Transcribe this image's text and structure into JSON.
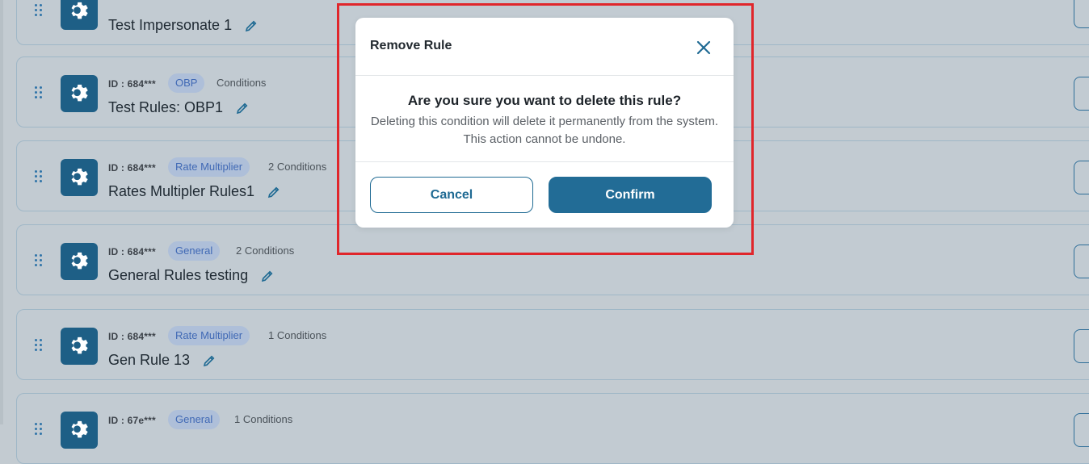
{
  "rules": [
    {
      "id": "",
      "badge": "",
      "conditions": "",
      "name": "Test Impersonate 1"
    },
    {
      "id": "ID : 684***",
      "badge": "OBP",
      "conditions": "Conditions",
      "name": "Test Rules: OBP1"
    },
    {
      "id": "ID : 684***",
      "badge": "Rate Multiplier",
      "conditions": "2 Conditions",
      "name": "Rates Multipler Rules1"
    },
    {
      "id": "ID : 684***",
      "badge": "General",
      "conditions": "2 Conditions",
      "name": "General Rules testing"
    },
    {
      "id": "ID : 684***",
      "badge": "Rate Multiplier",
      "conditions": "1 Conditions",
      "name": "Gen Rule 13"
    },
    {
      "id": "ID : 67e***",
      "badge": "General",
      "conditions": "1 Conditions",
      "name": ""
    }
  ],
  "modal": {
    "title": "Remove Rule",
    "question": "Are you sure you want to delete this rule?",
    "message": "Deleting this condition will delete it permanently from the system. This action cannot be undone.",
    "cancel_label": "Cancel",
    "confirm_label": "Confirm"
  },
  "colors": {
    "primary": "#226c96",
    "highlight": "#e0262b",
    "badge_text": "#4069b5"
  },
  "icons": {
    "rule": "gear-icon",
    "edit": "pencil-icon",
    "drag": "drag-handle-icon",
    "close": "close-icon"
  }
}
